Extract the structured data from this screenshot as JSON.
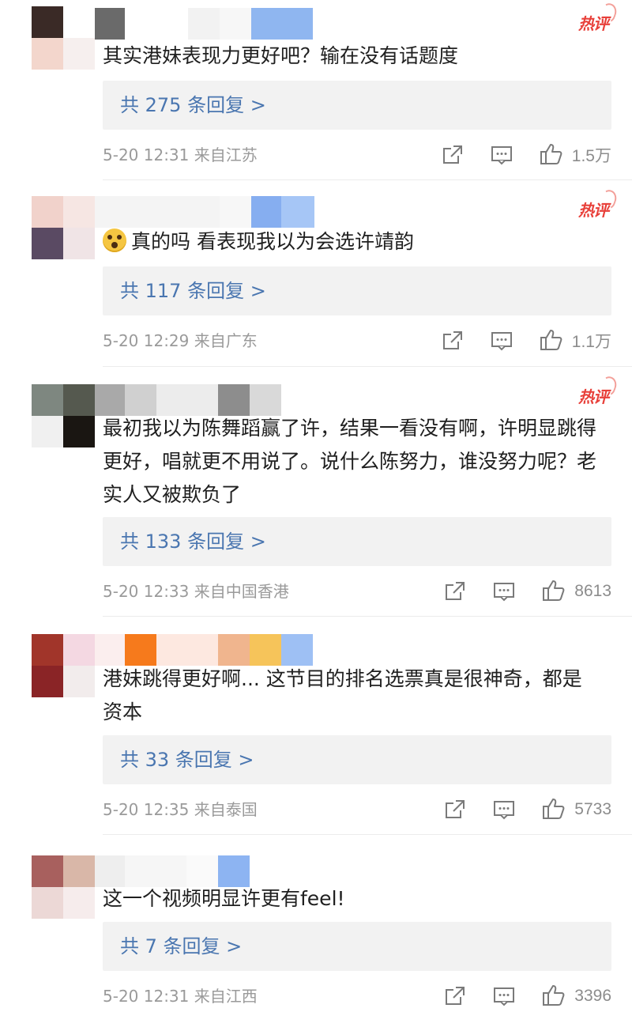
{
  "colors": {
    "reply_link": "#4a76b0",
    "hot_badge": "#e8403a",
    "meta_gray": "#9a9a9a",
    "reply_bg": "#f2f2f2"
  },
  "icons": {
    "share": "share-icon",
    "comment": "comment-icon",
    "like": "thumbs-up-icon"
  },
  "comments": [
    {
      "hot_badge": "热评",
      "text": "其实港妹表现力更好吧？输在没有话题度",
      "replies_label": "共 275 条回复 >",
      "time": "5-20 12:31",
      "source": "来自江苏",
      "likes": "1.5万"
    },
    {
      "hot_badge": "热评",
      "text": "真的吗 看表现我以为会选许靖韵",
      "emoji": "thinking-face-emoji",
      "replies_label": "共 117 条回复 >",
      "time": "5-20 12:29",
      "source": "来自广东",
      "likes": "1.1万"
    },
    {
      "hot_badge": "热评",
      "text": "最初我以为陈舞蹈赢了许，结果一看没有啊，许明显跳得更好，唱就更不用说了。说什么陈努力，谁没努力呢？老实人又被欺负了",
      "replies_label": "共 133 条回复 >",
      "time": "5-20 12:33",
      "source": "来自中国香港",
      "likes": "8613"
    },
    {
      "text": "港妹跳得更好啊... 这节目的排名选票真是很神奇，都是资本",
      "replies_label": "共 33 条回复 >",
      "time": "5-20 12:35",
      "source": "来自泰国",
      "likes": "5733"
    },
    {
      "text": "这一个视频明显许更有feel!",
      "replies_label": "共 7 条回复 >",
      "time": "5-20 12:31",
      "source": "来自江西",
      "likes": "3396"
    }
  ]
}
